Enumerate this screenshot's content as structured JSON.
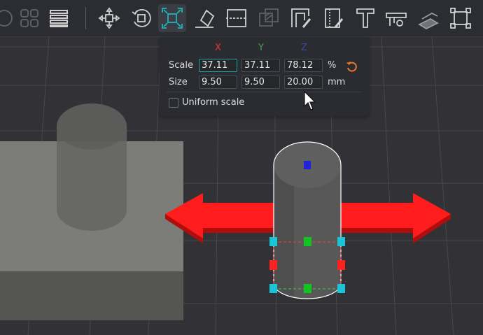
{
  "toolbar": {
    "tools": [
      {
        "icon": "cube-view-icon"
      },
      {
        "icon": "grid-view-icon"
      },
      {
        "icon": "menu-lines-icon"
      },
      {
        "icon": "move-icon"
      },
      {
        "icon": "rotate-icon"
      },
      {
        "icon": "scale-icon",
        "active": true
      },
      {
        "icon": "place-on-face-icon"
      },
      {
        "icon": "cut-icon"
      },
      {
        "icon": "mesh-boolean-icon"
      },
      {
        "icon": "paint-support-icon"
      },
      {
        "icon": "paint-seam-icon"
      },
      {
        "icon": "text-icon"
      },
      {
        "icon": "measure-icon"
      },
      {
        "icon": "assembly-icon"
      },
      {
        "icon": "fit-view-icon"
      }
    ]
  },
  "scale_panel": {
    "axes": {
      "x": "X",
      "y": "Y",
      "z": "Z"
    },
    "axis_colors": {
      "x": "#e53935",
      "y": "#43a047",
      "z": "#3949ab"
    },
    "scale": {
      "label": "Scale",
      "x": "37.11",
      "y": "37.11",
      "z": "78.12",
      "unit": "%"
    },
    "size": {
      "label": "Size",
      "x": "9.50",
      "y": "9.50",
      "z": "20.00",
      "unit": "mm"
    },
    "uniform_scale": {
      "label": "Uniform scale",
      "checked": false
    },
    "accent_color": "#e8772e"
  }
}
